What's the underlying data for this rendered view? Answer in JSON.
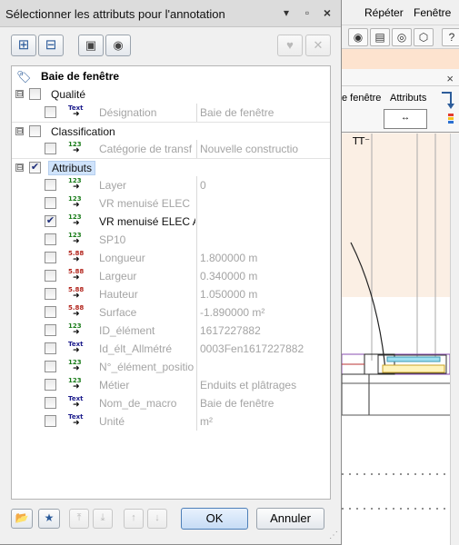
{
  "dialog": {
    "title": "Sélectionner les attributs pour l'annotation",
    "object_label": "Baie de fenêtre"
  },
  "groups": [
    {
      "label": "Qualité",
      "expander": "⊟",
      "checked": false,
      "highlight": false,
      "items": [
        {
          "name": "Désignation",
          "type": "Text",
          "value": "Baie de fenêtre",
          "checked": false,
          "active": false
        }
      ]
    },
    {
      "label": "Classification",
      "expander": "⊟",
      "checked": false,
      "highlight": false,
      "items": [
        {
          "name": "Catégorie de transf",
          "type": "123",
          "value": "Nouvelle constructio",
          "checked": false,
          "active": false
        }
      ]
    },
    {
      "label": "Attributs",
      "expander": "⊟",
      "checked": true,
      "highlight": true,
      "items": [
        {
          "name": "Layer",
          "type": "123",
          "value": "0",
          "checked": false,
          "active": false
        },
        {
          "name": "VR menuisé ELEC",
          "type": "123",
          "value": "",
          "checked": false,
          "active": false
        },
        {
          "name": "VR menuisé ELEC A",
          "type": "123",
          "value": "",
          "checked": true,
          "active": true
        },
        {
          "name": "SP10",
          "type": "123",
          "value": "",
          "checked": false,
          "active": false
        },
        {
          "name": "Longueur",
          "type": "5.88",
          "value": "1.800000 m",
          "checked": false,
          "active": false
        },
        {
          "name": "Largeur",
          "type": "5.88",
          "value": "0.340000 m",
          "checked": false,
          "active": false
        },
        {
          "name": "Hauteur",
          "type": "5.88",
          "value": "1.050000 m",
          "checked": false,
          "active": false
        },
        {
          "name": "Surface",
          "type": "5.88",
          "value": "-1.890000 m²",
          "checked": false,
          "active": false
        },
        {
          "name": "ID_élément",
          "type": "123",
          "value": "1617227882",
          "checked": false,
          "active": false
        },
        {
          "name": "Id_élt_Allmétré",
          "type": "Text",
          "value": "0003Fen1617227882",
          "checked": false,
          "active": false
        },
        {
          "name": "N°_élément_positio",
          "type": "123",
          "value": "",
          "checked": false,
          "active": false
        },
        {
          "name": "Métier",
          "type": "123",
          "value": "Enduits et plâtrages",
          "checked": false,
          "active": false
        },
        {
          "name": "Nom_de_macro",
          "type": "Text",
          "value": "Baie de fenêtre",
          "checked": false,
          "active": false
        },
        {
          "name": "Unité",
          "type": "Text",
          "value": "m²",
          "checked": false,
          "active": false
        }
      ]
    }
  ],
  "buttons": {
    "ok": "OK",
    "cancel": "Annuler"
  },
  "background": {
    "menu": [
      "Répéter",
      "Fenêtre"
    ],
    "panel_label_left": "e fenêtre",
    "panel_label_right": "Attributs",
    "attr_box": "↔"
  },
  "colors": {
    "type_text": "#1c1c8c",
    "type_int": "#1b7d1b",
    "type_real": "#b3261e",
    "check": "#1f2f7a"
  }
}
